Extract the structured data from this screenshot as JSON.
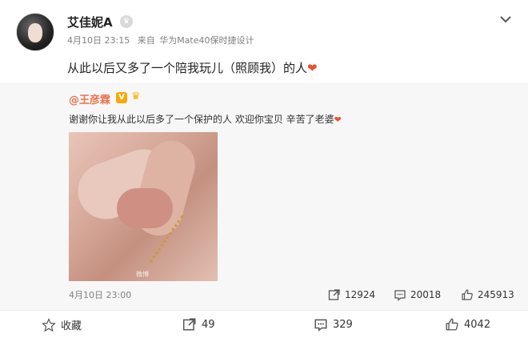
{
  "post": {
    "author": "艾佳妮A",
    "date": "4月10日 23:15",
    "source_prefix": "来自",
    "device": "华为Mate40保时捷设计",
    "text": "从此以后又多了一个陪我玩儿（照顾我）的人",
    "heart": "❤"
  },
  "quoted": {
    "author": "@王彦霖",
    "text": "谢谢你让我从此以后多了一个保护的人 欢迎你宝贝 辛苦了老婆",
    "heart": "❤",
    "date": "4月10日 23:00",
    "reposts": "12924",
    "comments": "20018",
    "likes": "245913",
    "image_watermark": "微博"
  },
  "actions": {
    "favorite": "收藏",
    "repost_count": "49",
    "comment_count": "329",
    "like_count": "4042"
  },
  "colors": {
    "quote_author": "#eb7350",
    "heart_red": "#e8522e",
    "meta_gray": "#808080",
    "quote_bg": "#f7f7f7"
  }
}
